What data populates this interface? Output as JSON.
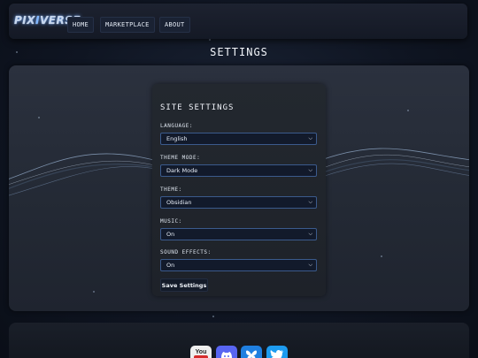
{
  "nav": {
    "logo_text": "PIXIVERSE",
    "links": [
      "HOME",
      "MARKETPLACE",
      "ABOUT"
    ]
  },
  "page_title": "SETTINGS",
  "settings": {
    "title": "SITE SETTINGS",
    "fields": [
      {
        "label": "LANGUAGE:",
        "value": "English"
      },
      {
        "label": "THEME MODE:",
        "value": "Dark Mode"
      },
      {
        "label": "THEME:",
        "value": "Obsidian"
      },
      {
        "label": "MUSIC:",
        "value": "On"
      },
      {
        "label": "SOUND EFFECTS:",
        "value": "On"
      }
    ],
    "save_label": "Save Settings"
  },
  "footer": {
    "social_icons": [
      "youtube-icon",
      "discord-icon",
      "bluesky-icon",
      "twitter-icon"
    ],
    "youtube_text": "You"
  },
  "colors": {
    "accent": "#3b5a8c",
    "background": "#0f1522",
    "panel": "#2b313e",
    "youtube": "#d62b2b",
    "discord": "#5865f2",
    "bluesky": "#1f7fe0",
    "twitter": "#1d9bf0"
  }
}
